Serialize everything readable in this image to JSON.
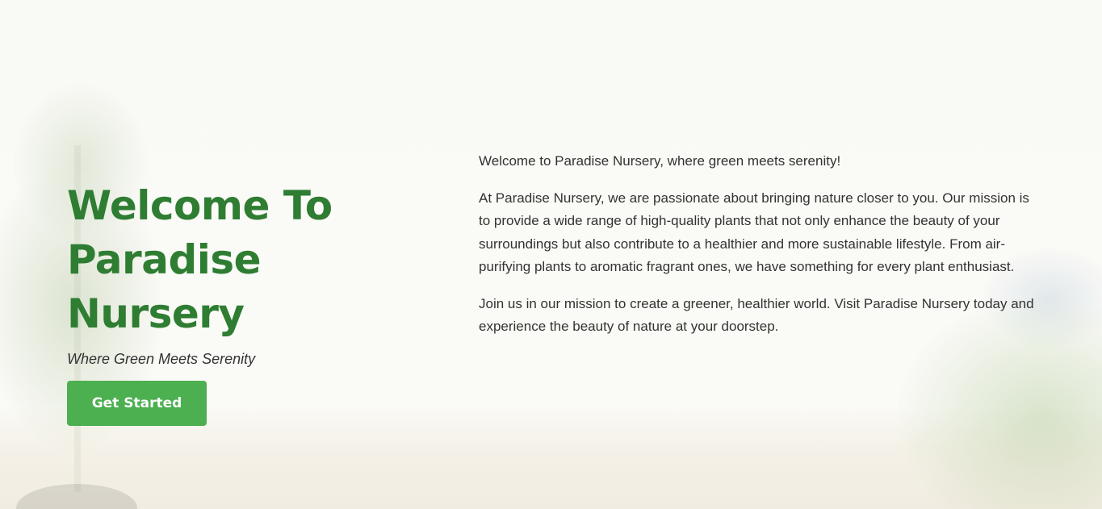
{
  "hero": {
    "title_line1": "Welcome To",
    "title_line2": "Paradise Nursery",
    "tagline": "Where Green Meets Serenity",
    "cta_label": "Get Started"
  },
  "about": {
    "intro": "Welcome to Paradise Nursery, where green meets serenity!",
    "mission": "At Paradise Nursery, we are passionate about bringing nature closer to you. Our mission is to provide a wide range of high-quality plants that not only enhance the beauty of your surroundings but also contribute to a healthier and more sustainable lifestyle. From air-purifying plants to aromatic fragrant ones, we have something for every plant enthusiast.",
    "closing": "Join us in our mission to create a greener, healthier world. Visit Paradise Nursery today and experience the beauty of nature at your doorstep."
  },
  "colors": {
    "title_green": "#2e7d32",
    "button_green": "#4caf50",
    "text": "#333333",
    "background": "#f7f7f2"
  }
}
